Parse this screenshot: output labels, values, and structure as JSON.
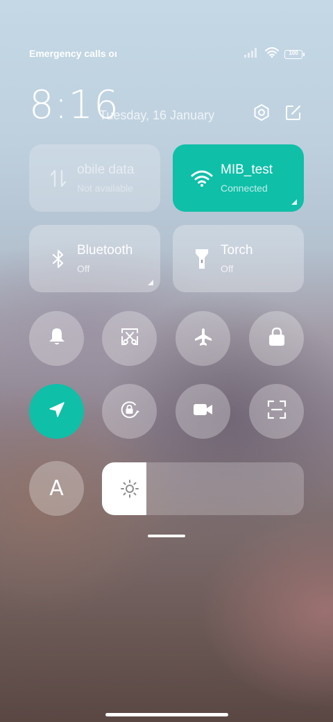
{
  "status_bar": {
    "text": "Emergency calls only",
    "battery": "100",
    "icons": [
      "signal-icon",
      "wifi-icon",
      "battery-icon"
    ]
  },
  "header": {
    "time": "8:16",
    "date": "Tuesday, 16 January",
    "icons": [
      "settings-icon",
      "edit-icon"
    ]
  },
  "tiles": {
    "mobile_data": {
      "title": "obile data",
      "subtitle": "Not available",
      "icon": "data-transfer-icon",
      "state": "disabled"
    },
    "wifi": {
      "title": "MIB_test",
      "subtitle": "Connected",
      "icon": "wifi-icon",
      "state": "on"
    },
    "bluetooth": {
      "title": "Bluetooth",
      "subtitle": "Off",
      "icon": "bluetooth-icon",
      "state": "off"
    },
    "torch": {
      "title": "Torch",
      "subtitle": "Off",
      "icon": "flashlight-icon",
      "state": "off"
    }
  },
  "toggles": [
    {
      "name": "ringer",
      "icon": "bell-icon",
      "active": false
    },
    {
      "name": "screenshot",
      "icon": "scissors-screenshot-icon",
      "active": false
    },
    {
      "name": "airplane-mode",
      "icon": "airplane-icon",
      "active": false
    },
    {
      "name": "lock-screen",
      "icon": "lock-icon",
      "active": false
    },
    {
      "name": "location",
      "icon": "location-arrow-icon",
      "active": true
    },
    {
      "name": "auto-rotate",
      "icon": "rotation-lock-icon",
      "active": false
    },
    {
      "name": "screen-recorder",
      "icon": "video-camera-icon",
      "active": false
    },
    {
      "name": "scanner",
      "icon": "scan-icon",
      "active": false
    }
  ],
  "auto_brightness": {
    "label": "A",
    "active": false
  },
  "brightness": {
    "level": 0.22,
    "icon": "sun-icon"
  },
  "colors": {
    "accent": "#0fbfa8",
    "tile": "rgba(255,255,255,0.28)"
  }
}
